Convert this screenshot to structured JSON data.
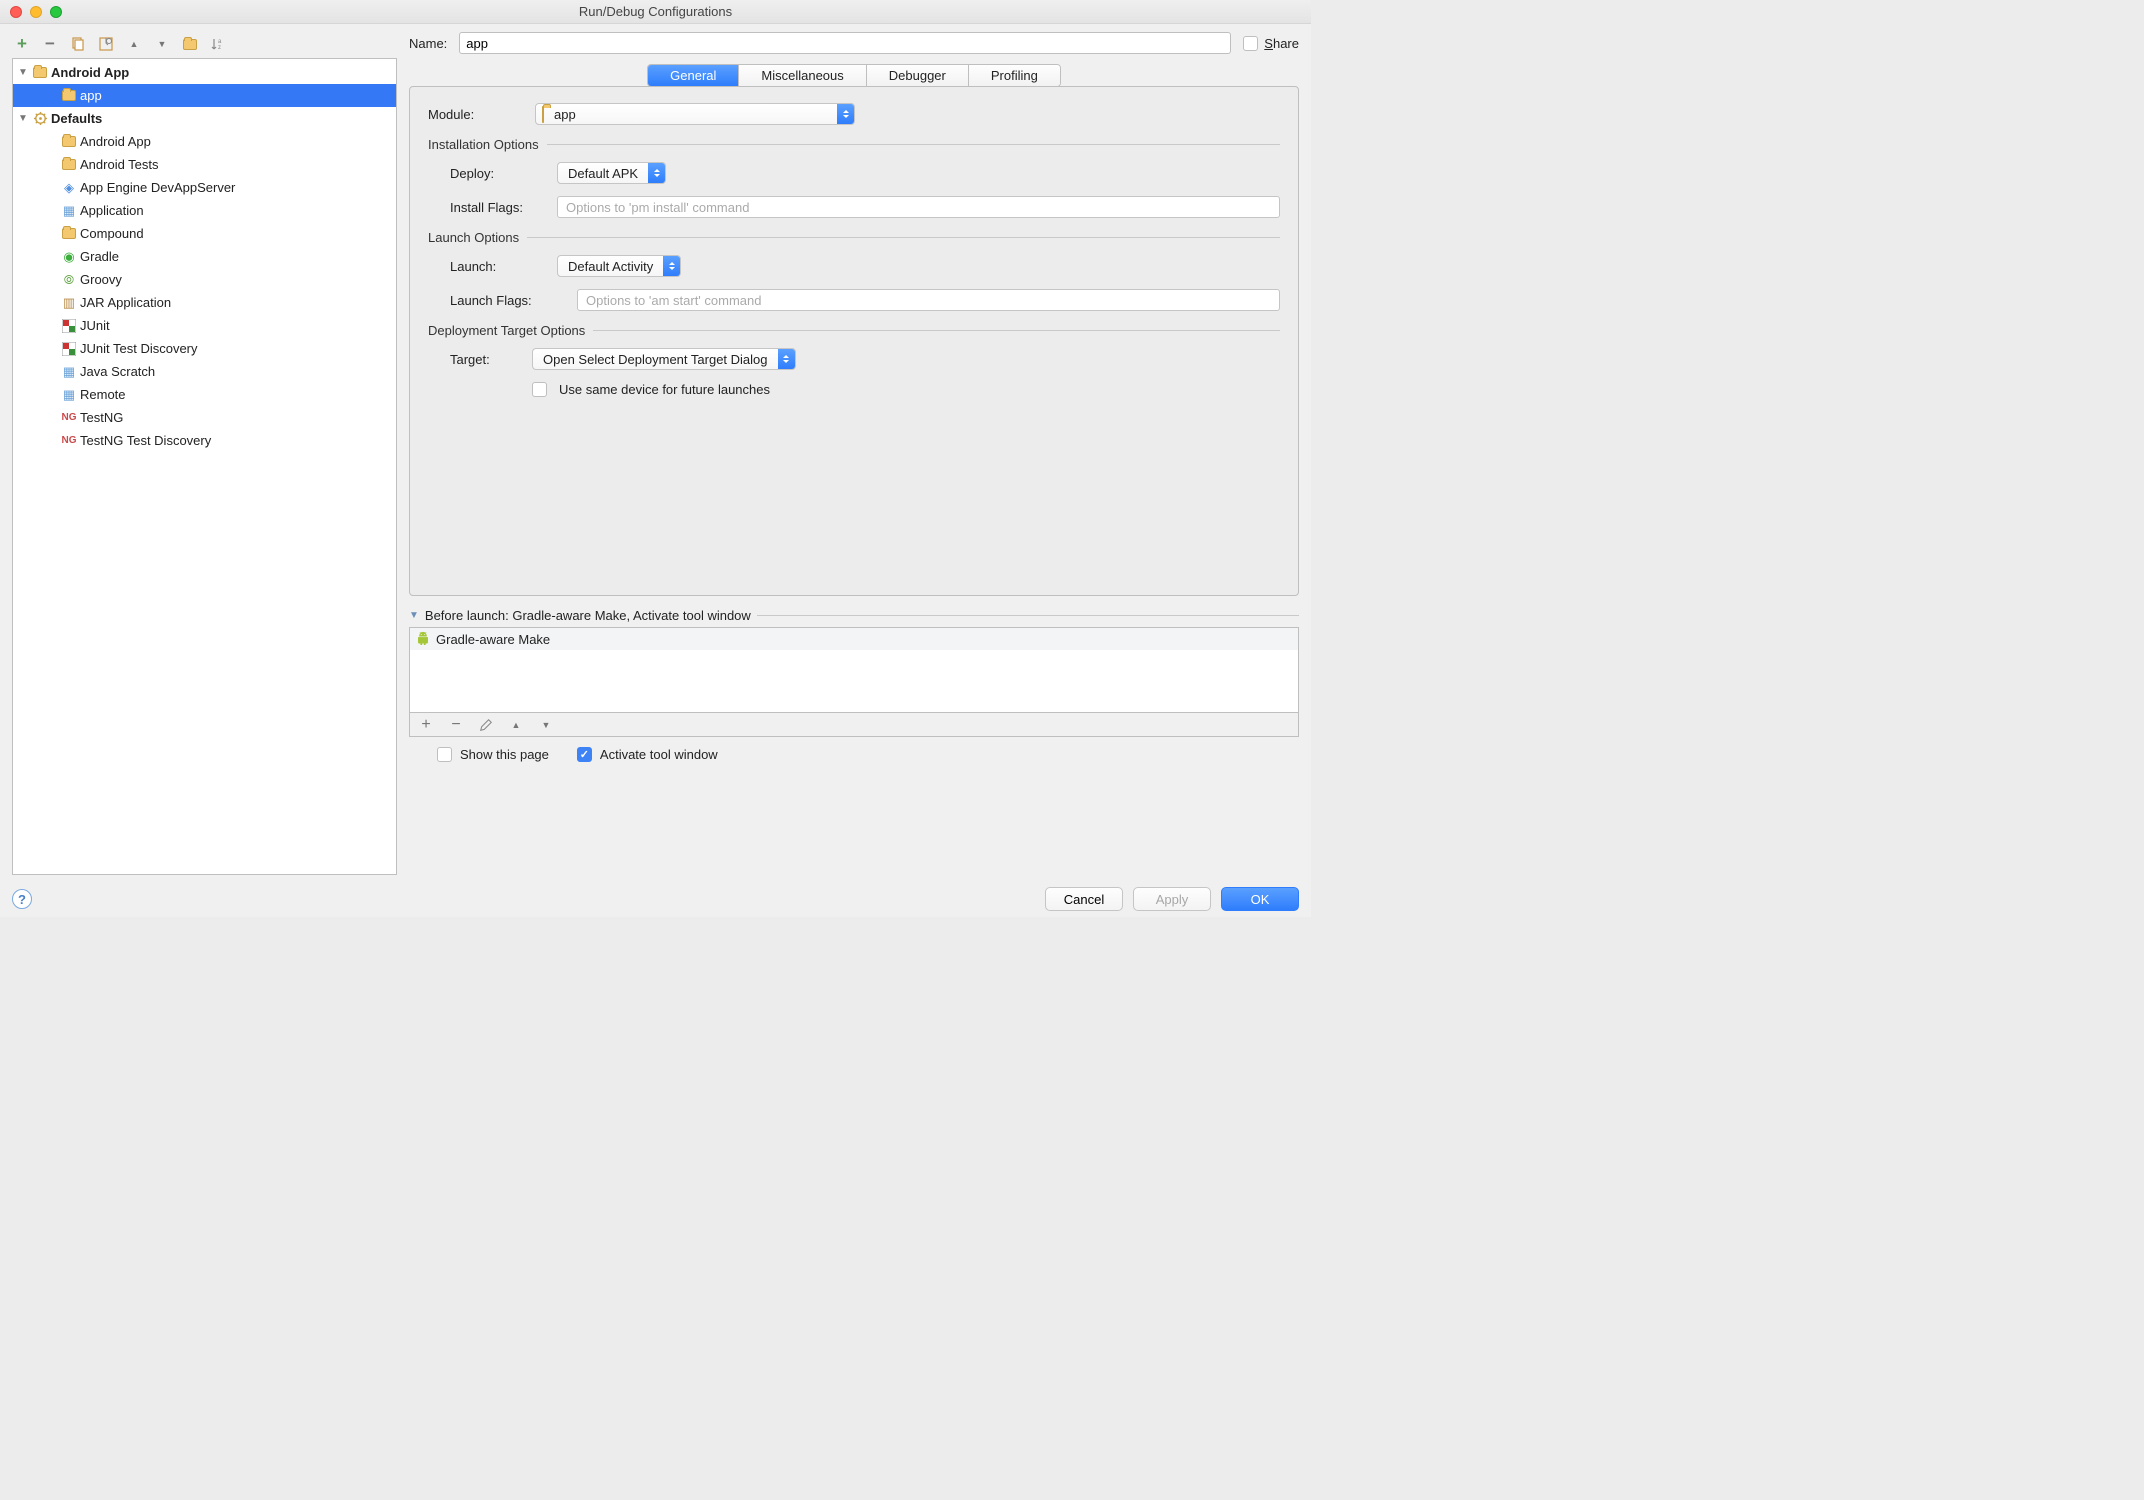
{
  "window": {
    "title": "Run/Debug Configurations"
  },
  "toolbar": {
    "add": "+",
    "remove": "−",
    "copy": "copy",
    "save": "save",
    "up": "▲",
    "down": "▼",
    "folder": "folder",
    "sort": "sort"
  },
  "tree": {
    "root1": {
      "label": "Android App"
    },
    "root1_children": [
      {
        "label": "app"
      }
    ],
    "root2": {
      "label": "Defaults"
    },
    "root2_children": [
      {
        "label": "Android App"
      },
      {
        "label": "Android Tests"
      },
      {
        "label": "App Engine DevAppServer"
      },
      {
        "label": "Application"
      },
      {
        "label": "Compound"
      },
      {
        "label": "Gradle"
      },
      {
        "label": "Groovy"
      },
      {
        "label": "JAR Application"
      },
      {
        "label": "JUnit"
      },
      {
        "label": "JUnit Test Discovery"
      },
      {
        "label": "Java Scratch"
      },
      {
        "label": "Remote"
      },
      {
        "label": "TestNG"
      },
      {
        "label": "TestNG Test Discovery"
      }
    ]
  },
  "form": {
    "name_label": "Name:",
    "name_value": "app",
    "share_label": "Share",
    "tabs": [
      "General",
      "Miscellaneous",
      "Debugger",
      "Profiling"
    ],
    "module_label": "Module:",
    "module_value": "app",
    "install_section": "Installation Options",
    "deploy_label": "Deploy:",
    "deploy_value": "Default APK",
    "install_flags_label": "Install Flags:",
    "install_flags_placeholder": "Options to 'pm install' command",
    "launch_section": "Launch Options",
    "launch_label": "Launch:",
    "launch_value": "Default Activity",
    "launch_flags_label": "Launch Flags:",
    "launch_flags_placeholder": "Options to 'am start' command",
    "target_section": "Deployment Target Options",
    "target_label": "Target:",
    "target_value": "Open Select Deployment Target Dialog",
    "same_device_label": "Use same device for future launches"
  },
  "before_launch": {
    "header": "Before launch: Gradle-aware Make, Activate tool window",
    "items": [
      {
        "label": "Gradle-aware Make"
      }
    ],
    "show_this_page": "Show this page",
    "activate_tool_window": "Activate tool window"
  },
  "footer": {
    "cancel": "Cancel",
    "apply": "Apply",
    "ok": "OK"
  }
}
